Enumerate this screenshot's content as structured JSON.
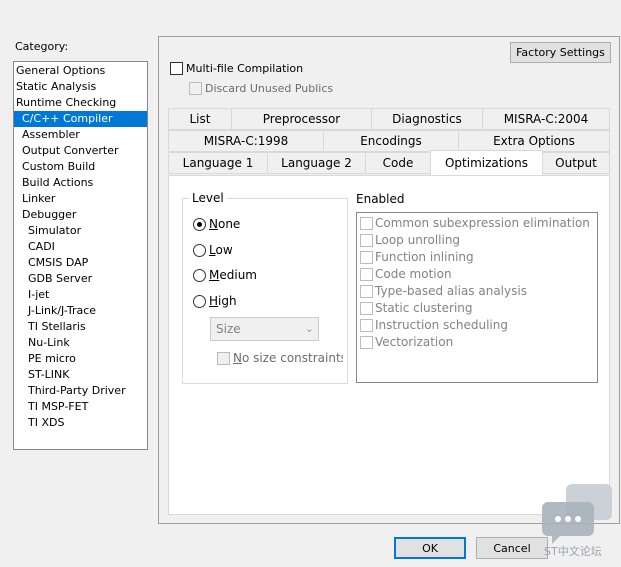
{
  "category": {
    "label": "Category:",
    "items": [
      {
        "label": "General Options",
        "indent": 0
      },
      {
        "label": "Static Analysis",
        "indent": 0
      },
      {
        "label": "Runtime Checking",
        "indent": 0
      },
      {
        "label": "C/C++ Compiler",
        "indent": 1,
        "selected": true
      },
      {
        "label": "Assembler",
        "indent": 1
      },
      {
        "label": "Output Converter",
        "indent": 1
      },
      {
        "label": "Custom Build",
        "indent": 1
      },
      {
        "label": "Build Actions",
        "indent": 1
      },
      {
        "label": "Linker",
        "indent": 1
      },
      {
        "label": "Debugger",
        "indent": 1
      },
      {
        "label": "Simulator",
        "indent": 2
      },
      {
        "label": "CADI",
        "indent": 2
      },
      {
        "label": "CMSIS DAP",
        "indent": 2
      },
      {
        "label": "GDB Server",
        "indent": 2
      },
      {
        "label": "I-jet",
        "indent": 2
      },
      {
        "label": "J-Link/J-Trace",
        "indent": 2
      },
      {
        "label": "TI Stellaris",
        "indent": 2
      },
      {
        "label": "Nu-Link",
        "indent": 2
      },
      {
        "label": "PE micro",
        "indent": 2
      },
      {
        "label": "ST-LINK",
        "indent": 2
      },
      {
        "label": "Third-Party Driver",
        "indent": 2
      },
      {
        "label": "TI MSP-FET",
        "indent": 2
      },
      {
        "label": "TI XDS",
        "indent": 2
      }
    ]
  },
  "toolbar": {
    "factory_settings": "Factory Settings",
    "multi_file": "Multi-file Compilation",
    "discard_publics": "Discard Unused Publics"
  },
  "tabs": {
    "row1": [
      "List",
      "Preprocessor",
      "Diagnostics",
      "MISRA-C:2004"
    ],
    "row2": [
      "MISRA-C:1998",
      "Encodings",
      "Extra Options"
    ],
    "row3": [
      "Language 1",
      "Language 2",
      "Code",
      "Optimizations",
      "Output"
    ],
    "active": "Optimizations"
  },
  "level": {
    "title": "Level",
    "options": [
      {
        "label": "None",
        "accel": "N",
        "rest": "one",
        "checked": true
      },
      {
        "label": "Low",
        "accel": "L",
        "rest": "ow",
        "checked": false
      },
      {
        "label": "Medium",
        "accel": "M",
        "rest": "edium",
        "checked": false
      },
      {
        "label": "High",
        "accel": "H",
        "rest": "igh",
        "checked": false
      }
    ],
    "size_select": "Size",
    "no_size_constraints_accel": "N",
    "no_size_constraints_rest": "o size constraints"
  },
  "enabled": {
    "title": "Enabled",
    "items": [
      "Common subexpression elimination",
      "Loop unrolling",
      "Function inlining",
      "Code motion",
      "Type-based alias analysis",
      "Static clustering",
      "Instruction scheduling",
      "Vectorization"
    ]
  },
  "dialog": {
    "ok": "OK",
    "cancel": "Cancel"
  },
  "watermark": {
    "text": "ST中文论坛"
  }
}
